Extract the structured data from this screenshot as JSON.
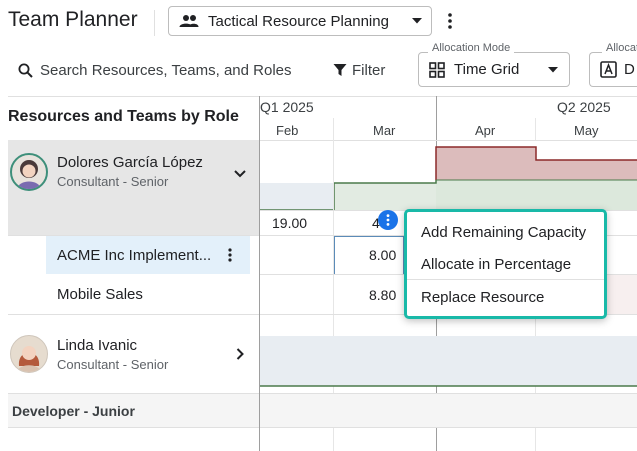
{
  "header": {
    "title": "Team Planner",
    "view_select": "Tactical Resource Planning"
  },
  "toolbar": {
    "search_label": "Search Resources, Teams, and Roles",
    "filter_label": "Filter",
    "mode_legend": "Allocation Mode",
    "mode_value": "Time Grid",
    "alloc_legend": "Allocat",
    "alloc_value": "D"
  },
  "sidebar": {
    "title": "Resources and Teams by Role"
  },
  "timeline": {
    "q1_label": "Q1 2025",
    "q2_label": "Q2 2025",
    "months": [
      "Feb",
      "Mar",
      "Apr",
      "May"
    ]
  },
  "resources": [
    {
      "name": "Dolores García López",
      "role": "Consultant - Senior",
      "feb_value": "19.00",
      "mar_value": "4",
      "assignments": [
        {
          "label": "ACME Inc Implement...",
          "mar_value": "8.00"
        },
        {
          "label": "Mobile Sales",
          "mar_value": "8.80"
        }
      ]
    },
    {
      "name": "Linda Ivanic",
      "role": "Consultant - Senior"
    }
  ],
  "groups": [
    {
      "label": "Developer - Junior"
    }
  ],
  "context_menu": {
    "items": [
      "Add Remaining Capacity",
      "Allocate in Percentage",
      "Replace Resource"
    ]
  },
  "colors": {
    "accent_teal": "#19b9a8",
    "overallocation_red": "#dcbcbc",
    "overallocation_line": "#8b2a2a",
    "capacity_green": "#dce8dc",
    "capacity_line": "#4a7a4a",
    "action_blue": "#1a73e8",
    "selected_row": "#e3f0fa"
  }
}
